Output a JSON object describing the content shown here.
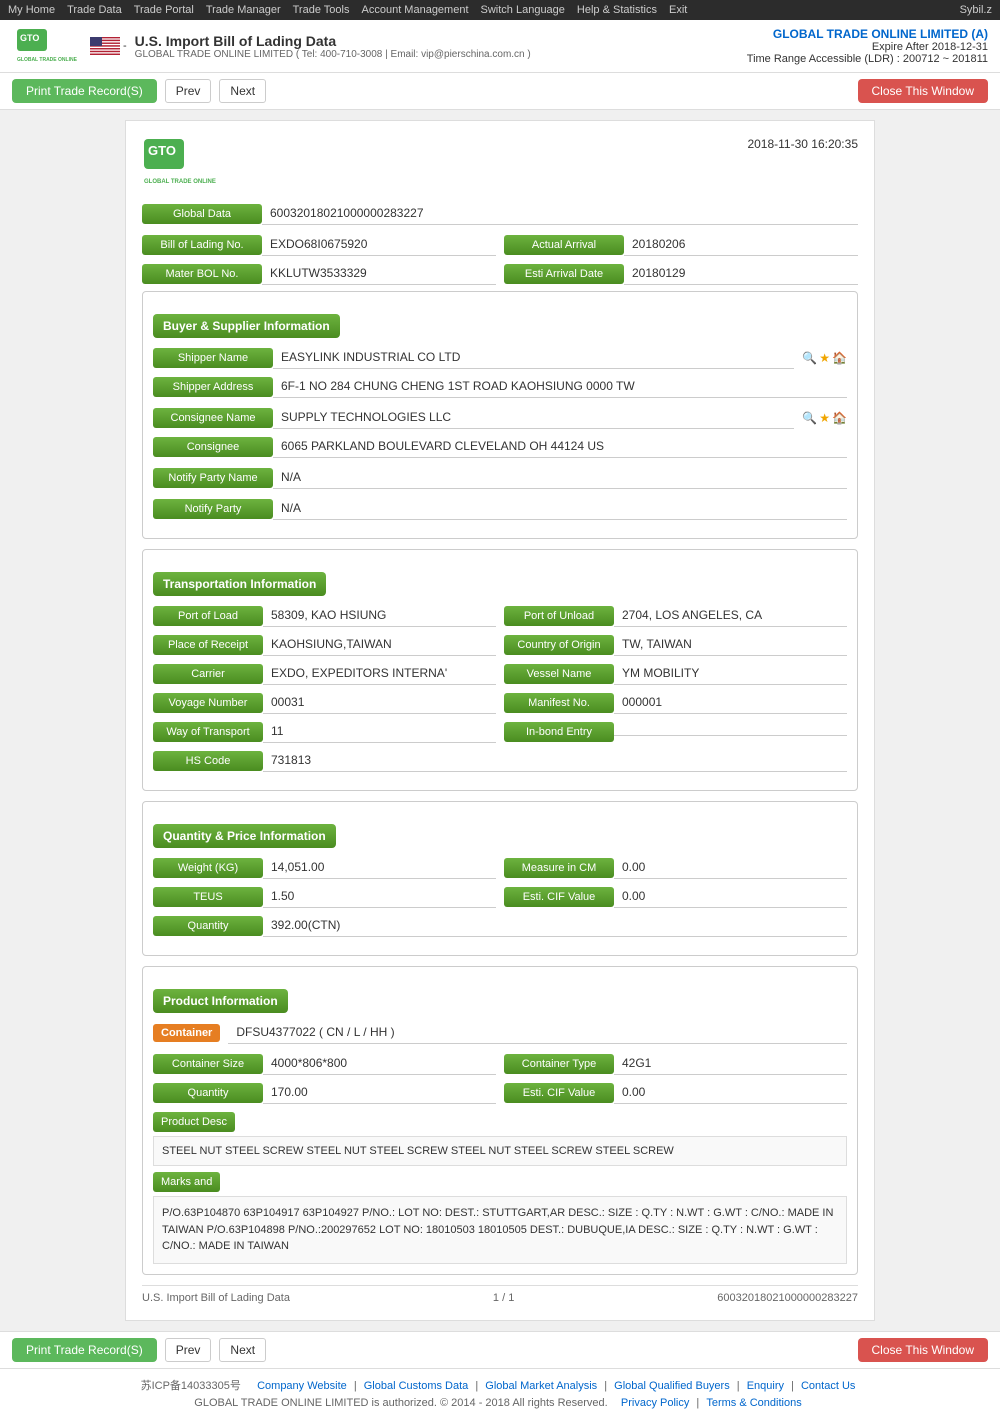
{
  "topnav": {
    "items": [
      "My Home",
      "Trade Data",
      "Trade Portal",
      "Trade Manager",
      "Trade Tools",
      "Account Management",
      "Switch Language",
      "Help & Statistics",
      "Exit"
    ],
    "user": "Sybil.z"
  },
  "header": {
    "title": "U.S. Import Bill of Lading Data",
    "subtitle": "GLOBAL TRADE ONLINE LIMITED ( Tel: 400-710-3008 | Email: vip@pierschina.com.cn )",
    "company": "GLOBAL TRADE ONLINE LIMITED (A)",
    "expire": "Expire After 2018-12-31",
    "time_range": "Time Range Accessible (LDR) : 200712 ~ 201811"
  },
  "toolbar": {
    "print_label": "Print Trade Record(S)",
    "prev_label": "Prev",
    "next_label": "Next",
    "close_label": "Close This Window"
  },
  "document": {
    "datetime": "2018-11-30 16:20:35",
    "global_data": "60032018021000000283227",
    "bill_of_lading_no": {
      "label": "Bill of Lading No.",
      "value": "EXDO68I0675920",
      "actual_arrival_label": "Actual Arrival",
      "actual_arrival_value": "20180206"
    },
    "master_bol": {
      "label": "Mater BOL No.",
      "value": "KKLUTW3533329",
      "esti_arrival_label": "Esti Arrival Date",
      "esti_arrival_value": "20180129"
    },
    "sections": {
      "buyer_supplier": {
        "label": "Buyer & Supplier Information",
        "shipper_name_label": "Shipper Name",
        "shipper_name_value": "EASYLINK INDUSTRIAL CO LTD",
        "shipper_address_label": "Shipper Address",
        "shipper_address_value": "6F-1 NO 284 CHUNG CHENG 1ST ROAD KAOHSIUNG 0000 TW",
        "consignee_name_label": "Consignee Name",
        "consignee_name_value": "SUPPLY TECHNOLOGIES LLC",
        "consignee_label": "Consignee",
        "consignee_value": "6065 PARKLAND BOULEVARD CLEVELAND OH 44124 US",
        "notify_party_name_label": "Notify Party Name",
        "notify_party_name_value": "N/A",
        "notify_party_label": "Notify Party",
        "notify_party_value": "N/A"
      },
      "transportation": {
        "label": "Transportation Information",
        "port_of_load_label": "Port of Load",
        "port_of_load_value": "58309, KAO HSIUNG",
        "port_of_unload_label": "Port of Unload",
        "port_of_unload_value": "2704, LOS ANGELES, CA",
        "place_of_receipt_label": "Place of Receipt",
        "place_of_receipt_value": "KAOHSIUNG,TAIWAN",
        "country_of_origin_label": "Country of Origin",
        "country_of_origin_value": "TW, TAIWAN",
        "carrier_label": "Carrier",
        "carrier_value": "EXDO, EXPEDITORS INTERNA'",
        "vessel_name_label": "Vessel Name",
        "vessel_name_value": "YM MOBILITY",
        "voyage_number_label": "Voyage Number",
        "voyage_number_value": "00031",
        "manifest_no_label": "Manifest No.",
        "manifest_no_value": "000001",
        "way_of_transport_label": "Way of Transport",
        "way_of_transport_value": "11",
        "in_bond_entry_label": "In-bond Entry",
        "in_bond_entry_value": "",
        "hs_code_label": "HS Code",
        "hs_code_value": "731813"
      },
      "quantity_price": {
        "label": "Quantity & Price Information",
        "weight_label": "Weight (KG)",
        "weight_value": "14,051.00",
        "measure_label": "Measure in CM",
        "measure_value": "0.00",
        "teus_label": "TEUS",
        "teus_value": "1.50",
        "esti_cif_label": "Esti. CIF Value",
        "esti_cif_value": "0.00",
        "quantity_label": "Quantity",
        "quantity_value": "392.00(CTN)"
      },
      "product": {
        "label": "Product Information",
        "container_label": "Container",
        "container_value": "DFSU4377022 ( CN / L / HH )",
        "container_size_label": "Container Size",
        "container_size_value": "4000*806*800",
        "container_type_label": "Container Type",
        "container_type_value": "42G1",
        "quantity_label": "Quantity",
        "quantity_value": "170.00",
        "esti_cif_label": "Esti. CIF Value",
        "esti_cif_value": "0.00",
        "product_desc_label": "Product Desc",
        "product_desc_value": "STEEL NUT STEEL SCREW STEEL NUT STEEL SCREW STEEL NUT STEEL SCREW STEEL SCREW",
        "marks_label": "Marks and",
        "marks_value": "P/O.63P104870 63P104917 63P104927 P/NO.: LOT NO: DEST.: STUTTGART,AR DESC.: SIZE : Q.TY : N.WT : G.WT : C/NO.: MADE IN TAIWAN P/O.63P104898 P/NO.:200297652 LOT NO: 18010503 18010505 DEST.: DUBUQUE,IA DESC.: SIZE : Q.TY : N.WT : G.WT : C/NO.: MADE IN TAIWAN"
      }
    },
    "footer": {
      "source": "U.S. Import Bill of Lading Data",
      "page": "1 / 1",
      "record_no": "60032018021000000283227"
    }
  },
  "page_footer": {
    "links": [
      "Company Website",
      "Global Customs Data",
      "Global Market Analysis",
      "Global Qualified Buyers",
      "Enquiry",
      "Contact Us"
    ],
    "copyright": "GLOBAL TRADE ONLINE LIMITED is authorized. © 2014 - 2018 All rights Reserved.",
    "policy_links": [
      "Privacy Policy",
      "Terms & Conditions"
    ],
    "icp": "苏ICP备14033305号"
  }
}
